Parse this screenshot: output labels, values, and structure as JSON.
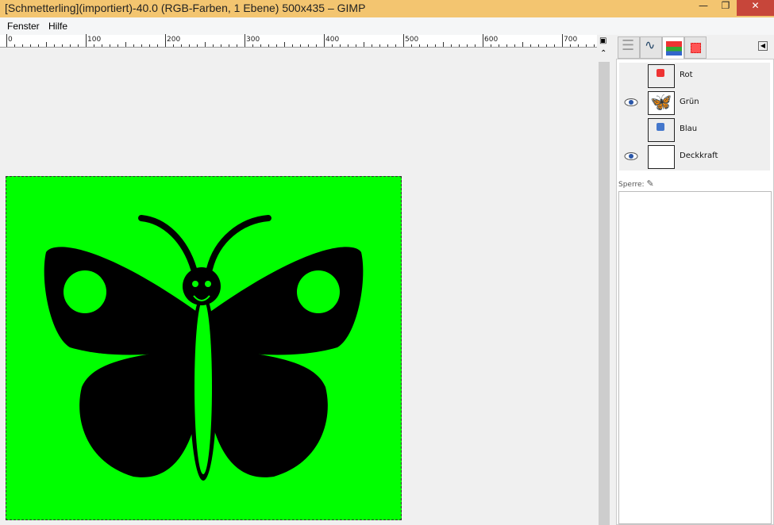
{
  "window": {
    "title": "[Schmetterling](importiert)-40.0 (RGB-Farben, 1 Ebene) 500x435 – GIMP"
  },
  "menu": [
    "Fenster",
    "Hilfe"
  ],
  "ruler": {
    "labels": [
      "0",
      "100",
      "200",
      "300",
      "400",
      "500",
      "600",
      "700"
    ]
  },
  "dock": {
    "tabs": [
      "layers-icon",
      "paths-icon",
      "channels-icon",
      "colormap-icon"
    ],
    "channels": [
      {
        "name": "Rot",
        "visible": false
      },
      {
        "name": "Grün",
        "visible": true
      },
      {
        "name": "Blau",
        "visible": false
      },
      {
        "name": "Deckkraft",
        "visible": true
      }
    ],
    "lock_label": "Sperre:"
  },
  "colors": {
    "canvas": "#00ff00",
    "titlebar": "#f3c570"
  }
}
